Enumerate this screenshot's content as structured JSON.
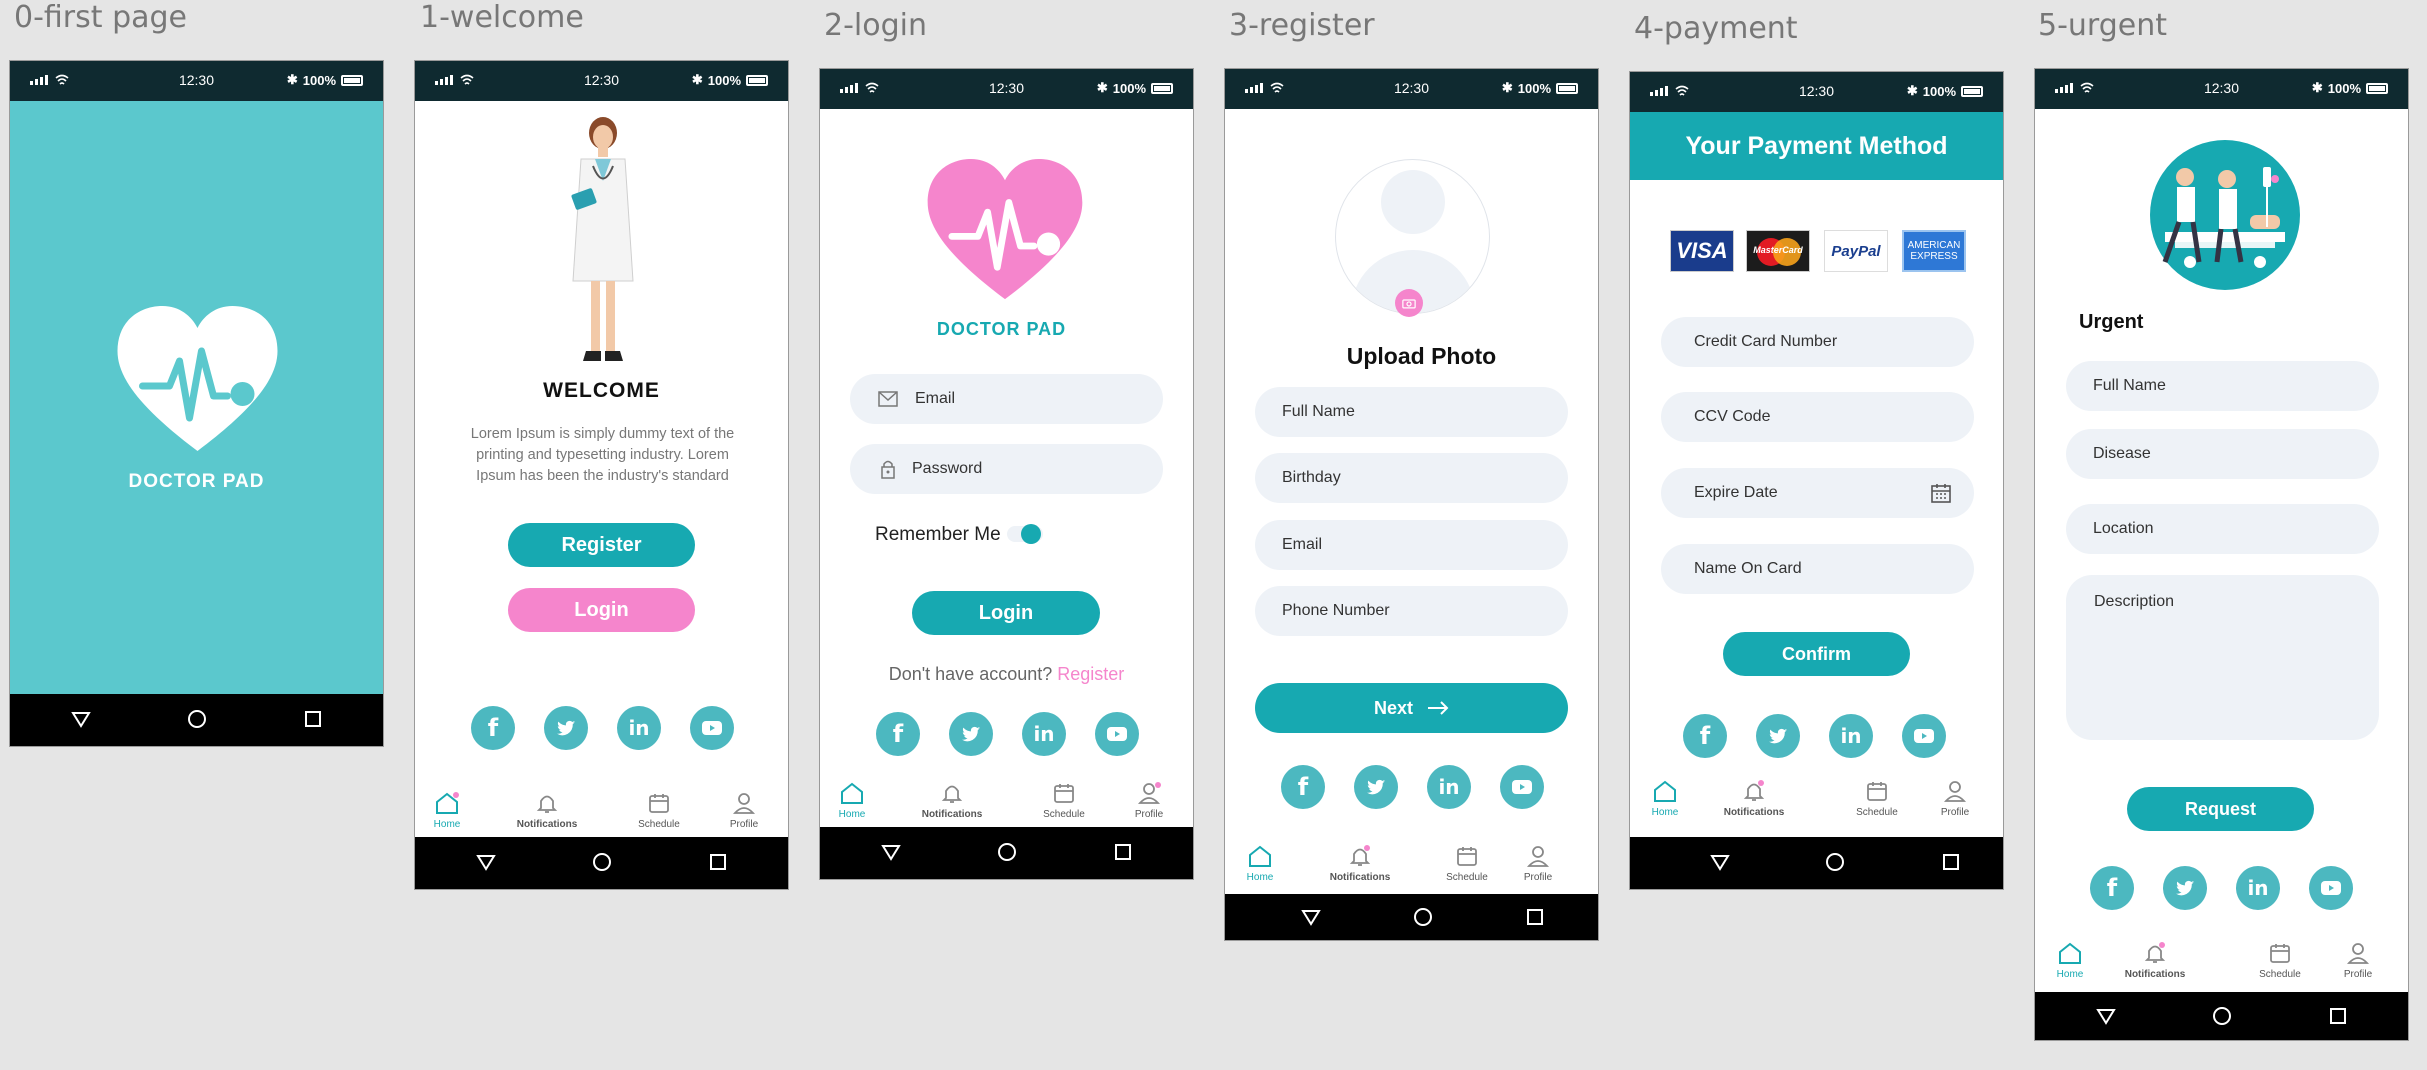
{
  "colors": {
    "teal": "#17a9b1",
    "teal_light": "#5bc8cd",
    "pink": "#f585cc",
    "dark_status": "#0f2a30",
    "field_bg": "#eef2f7"
  },
  "status": {
    "time": "12:30",
    "battery": "100%"
  },
  "brand": {
    "name": "DOCTOR PAD"
  },
  "tabs": [
    {
      "label": "Home",
      "icon": "home-icon"
    },
    {
      "label": "Notifications",
      "icon": "bell-icon"
    },
    {
      "label": "Schedule",
      "icon": "calendar-icon"
    },
    {
      "label": "Profile",
      "icon": "user-icon"
    }
  ],
  "social_icons": [
    "facebook-icon",
    "twitter-icon",
    "linkedin-icon",
    "youtube-icon"
  ],
  "frames": {
    "first_page": {
      "label": "0-first page"
    },
    "welcome": {
      "label": "1-welcome",
      "heading": "WELCOME",
      "body": "Lorem Ipsum is simply dummy text of the printing and typesetting industry. Lorem Ipsum has been the industry's standard",
      "register_button": "Register",
      "login_button": "Login"
    },
    "login": {
      "label": "2-login",
      "email_placeholder": "Email",
      "password_placeholder": "Password",
      "remember_me": "Remember Me",
      "login_button": "Login",
      "no_account_text": "Don't have account?",
      "register_link": "Register"
    },
    "register": {
      "label": "3-register",
      "upload_photo": "Upload Photo",
      "fields": [
        "Full Name",
        "Birthday",
        "Email",
        "Phone Number"
      ],
      "next_button": "Next"
    },
    "payment": {
      "label": "4-payment",
      "title": "Your Payment Method",
      "cards": [
        "VISA",
        "MasterCard",
        "PayPal",
        "AMERICAN EXPRESS"
      ],
      "fields": [
        "Credit Card Number",
        "CCV Code",
        "Expire Date",
        "Name On Card"
      ],
      "confirm_button": "Confirm"
    },
    "urgent": {
      "label": "5-urgent",
      "heading": "Urgent",
      "fields": [
        "Full Name",
        "Disease",
        "Location"
      ],
      "description_placeholder": "Description",
      "request_button": "Request"
    }
  }
}
